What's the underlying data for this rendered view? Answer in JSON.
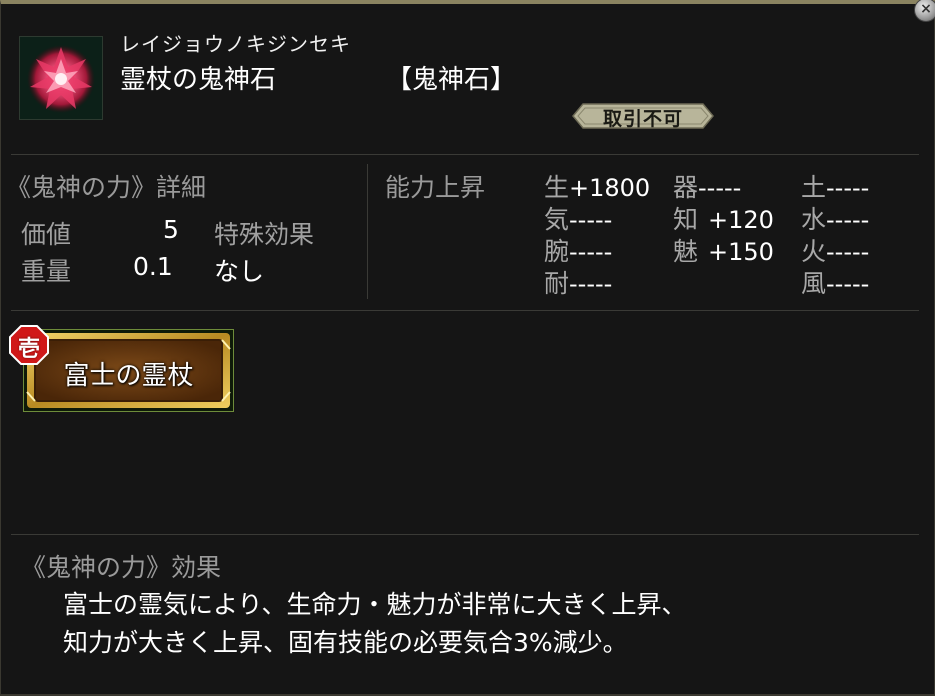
{
  "item": {
    "reading": "レイジョウノキジンセキ",
    "name": "霊杖の鬼神石",
    "type": "【鬼神石】",
    "trade_status": "取引不可",
    "icon": "red-crystal-icon"
  },
  "details": {
    "heading": "《鬼神の力》詳細",
    "value_label": "価値",
    "value": "5",
    "special_label": "特殊効果",
    "weight_label": "重量",
    "weight": "0.1",
    "special_value": "なし"
  },
  "abilities": {
    "heading": "能力上昇",
    "rows": [
      {
        "name": "生",
        "value": "+1800"
      },
      {
        "name": "器",
        "value": "-----"
      },
      {
        "name": "土",
        "value": "-----"
      },
      {
        "name": "気",
        "value": "-----"
      },
      {
        "name": "知",
        "value": "+120"
      },
      {
        "name": "水",
        "value": "-----"
      },
      {
        "name": "腕",
        "value": "-----"
      },
      {
        "name": "魅",
        "value": "+150"
      },
      {
        "name": "火",
        "value": "-----"
      },
      {
        "name": "耐",
        "value": "-----"
      },
      {
        "name": "風",
        "value": "-----"
      }
    ]
  },
  "tag": {
    "number": "壱",
    "label": "富士の霊杖"
  },
  "effect": {
    "heading": "《鬼神の力》効果",
    "line1": "富士の霊気により、生命力・魅力が非常に大きく上昇、",
    "line2": "知力が大きく上昇、固有技能の必要気合3%減少。"
  },
  "colors": {
    "frame": "#8a8360",
    "badge": "#b8b59a",
    "plaque_gold": "#c9a63a",
    "plaque_center": "#6b3a10",
    "tag_red": "#d01818"
  }
}
